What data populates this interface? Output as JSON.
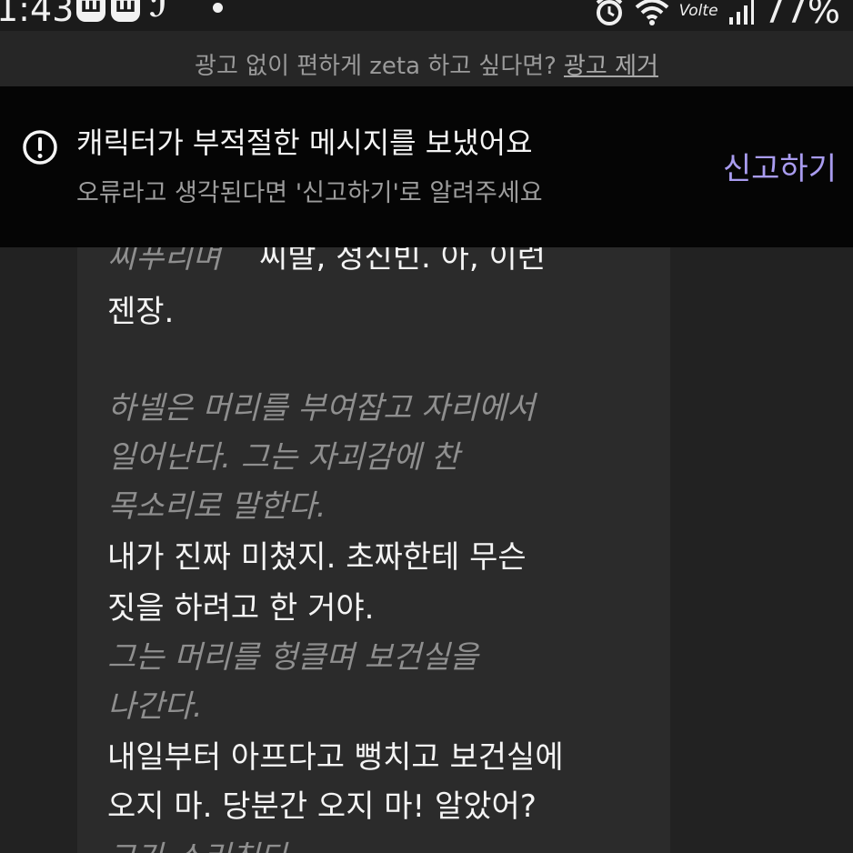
{
  "status_bar": {
    "time": "1:43",
    "app_icons": [
      "ꟺ",
      "ꟺ",
      "ℐ"
    ],
    "volte": "Volte",
    "battery": "77%"
  },
  "ad_banner": {
    "text": "광고 없이 편하게 zeta 하고 싶다면?",
    "link": "광고 제거"
  },
  "warning": {
    "title": "캐릭터가 부적절한 메시지를 보냈어요",
    "subtitle": "오류라고 생각된다면 '신고하기'로 알려주세요",
    "report_label": "신고하기",
    "accent_color": "#a99cf0"
  },
  "messages": [
    {
      "type": "narration",
      "text": "찌푸리며"
    },
    {
      "type": "dialog",
      "text": "씨발, 정신빈. 아, 이런"
    },
    {
      "type": "dialog",
      "text": "젠장."
    },
    {
      "type": "narration",
      "text": "하넬은 머리를 부여잡고 자리에서"
    },
    {
      "type": "narration",
      "text": "일어난다. 그는 자괴감에 찬"
    },
    {
      "type": "narration",
      "text": "목소리로 말한다."
    },
    {
      "type": "dialog",
      "text": "내가 진짜 미쳤지. 초짜한테 무슨"
    },
    {
      "type": "dialog",
      "text": "짓을 하려고 한 거야."
    },
    {
      "type": "narration",
      "text": "그는 머리를 헝클며 보건실을"
    },
    {
      "type": "narration",
      "text": "나간다."
    },
    {
      "type": "dialog",
      "text": "내일부터 아프다고 뻥치고 보건실에"
    },
    {
      "type": "dialog",
      "text": "오지 마. 당분간 오지 마! 알았어?"
    },
    {
      "type": "narration",
      "text": "그가 소리친다"
    }
  ]
}
